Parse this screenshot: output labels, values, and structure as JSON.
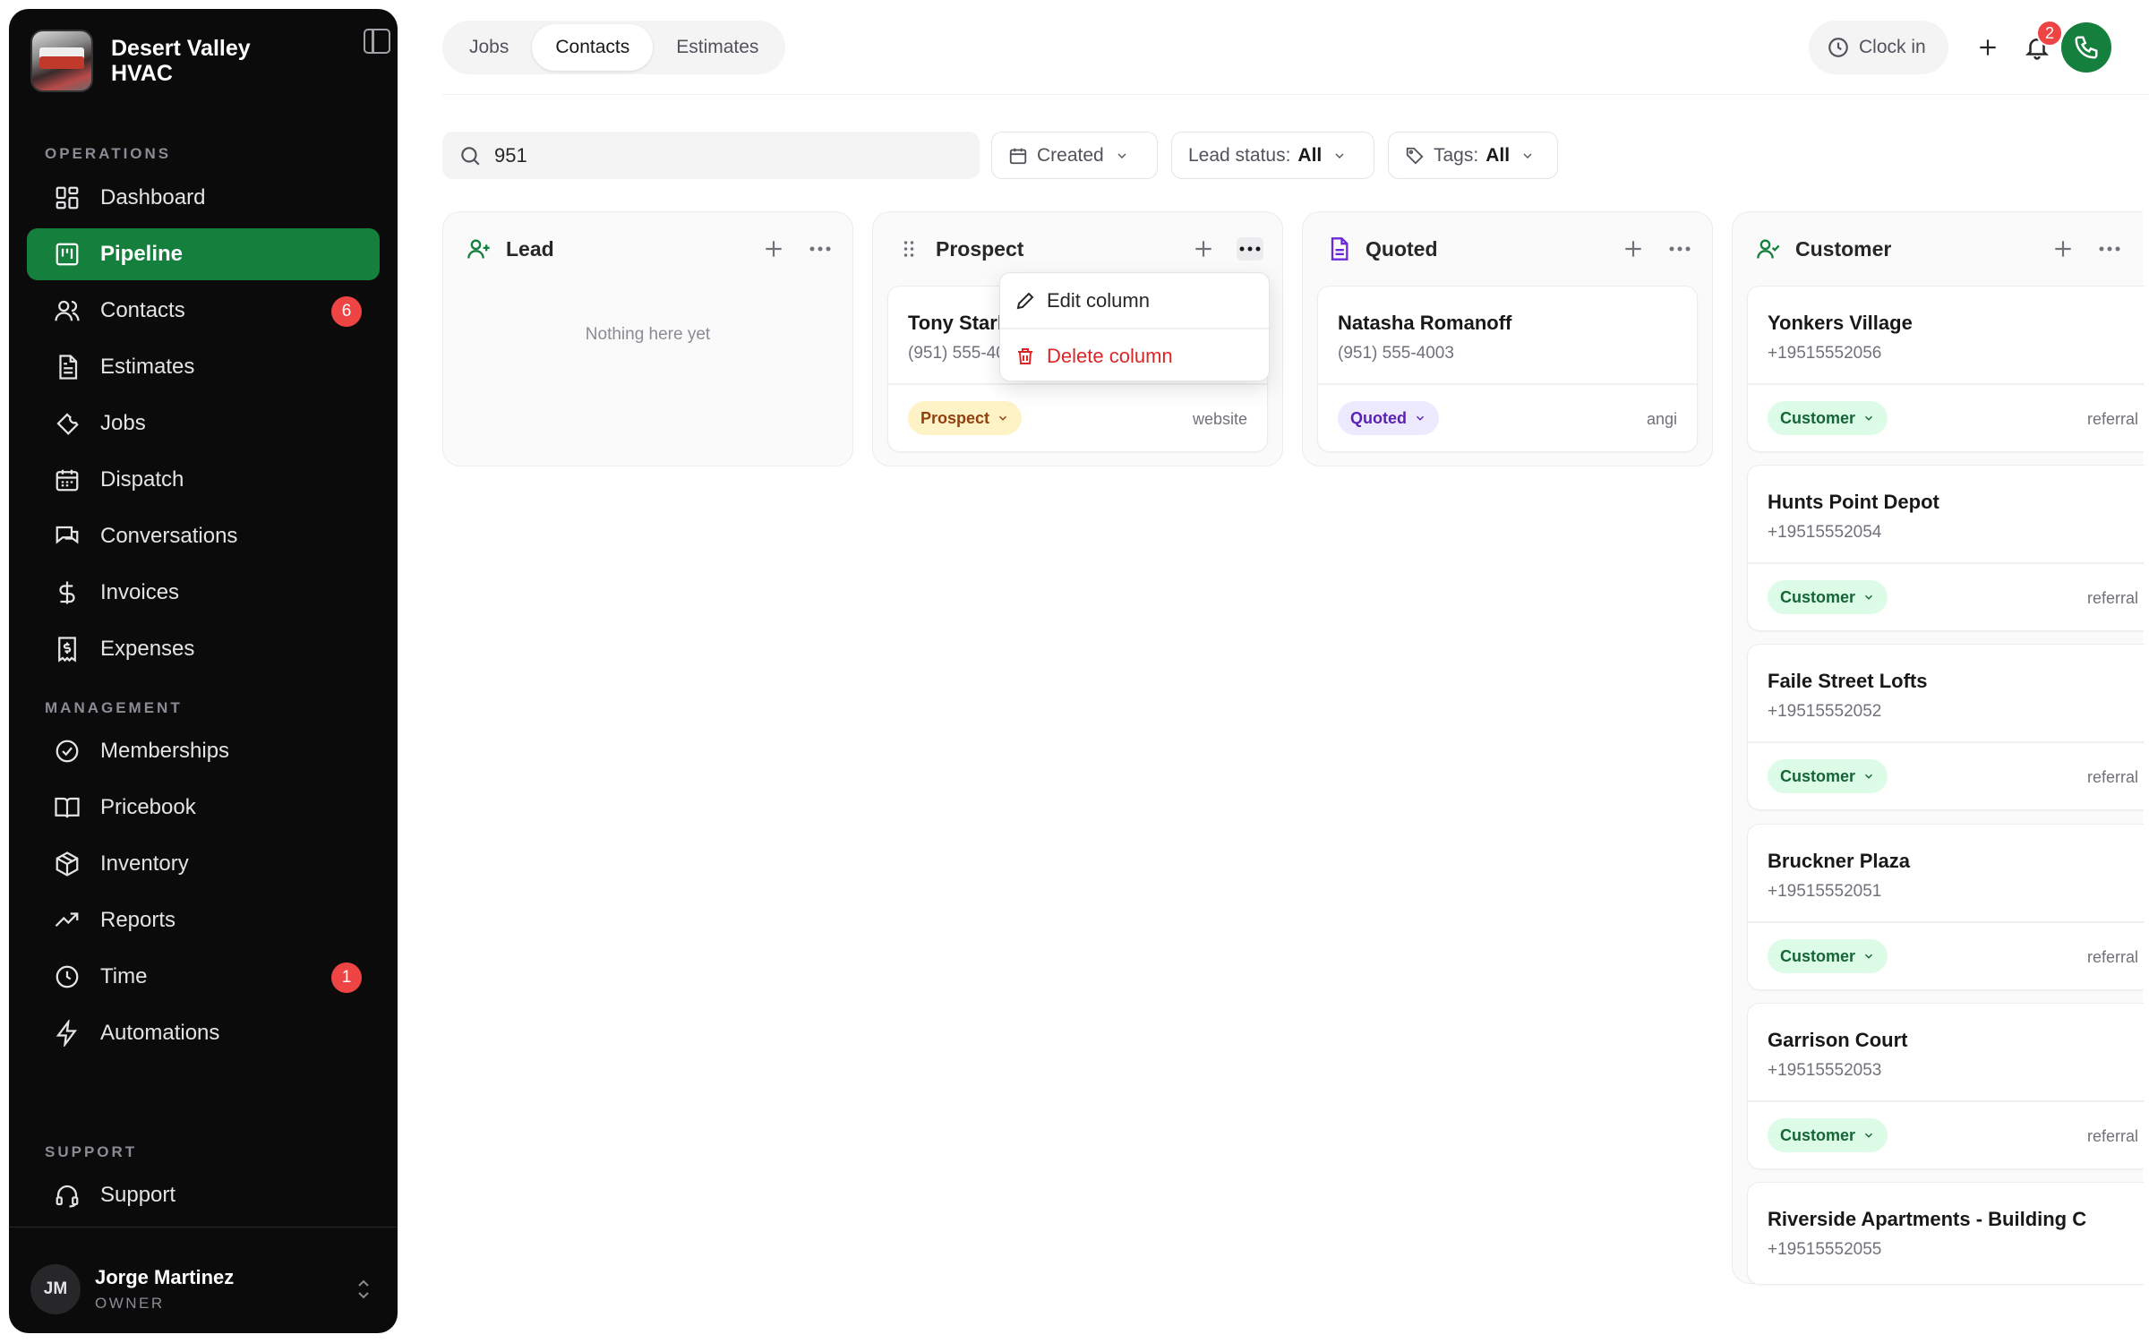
{
  "company": {
    "name": "Desert Valley HVAC"
  },
  "sidebar": {
    "sections": {
      "operations": "OPERATIONS",
      "management": "MANAGEMENT",
      "support": "SUPPORT"
    },
    "items": [
      {
        "label": "Dashboard",
        "icon": "dashboard-icon"
      },
      {
        "label": "Pipeline",
        "icon": "pipeline-icon",
        "active": true
      },
      {
        "label": "Contacts",
        "icon": "contacts-icon",
        "badge": "6"
      },
      {
        "label": "Estimates",
        "icon": "estimates-icon"
      },
      {
        "label": "Jobs",
        "icon": "wrench-icon"
      },
      {
        "label": "Dispatch",
        "icon": "calendar-icon"
      },
      {
        "label": "Conversations",
        "icon": "chat-icon"
      },
      {
        "label": "Invoices",
        "icon": "dollar-icon"
      },
      {
        "label": "Expenses",
        "icon": "receipt-icon"
      },
      {
        "label": "Memberships",
        "icon": "badge-check-icon"
      },
      {
        "label": "Pricebook",
        "icon": "book-icon"
      },
      {
        "label": "Inventory",
        "icon": "box-icon"
      },
      {
        "label": "Reports",
        "icon": "trend-icon"
      },
      {
        "label": "Time",
        "icon": "clock-icon",
        "badge": "1"
      },
      {
        "label": "Automations",
        "icon": "bolt-icon"
      },
      {
        "label": "Support",
        "icon": "headset-icon"
      }
    ]
  },
  "user": {
    "initials": "JM",
    "name": "Jorge Martinez",
    "role": "OWNER"
  },
  "tabs": [
    "Jobs",
    "Contacts",
    "Estimates"
  ],
  "topbar": {
    "clock_in": "Clock in",
    "notifications": "2"
  },
  "filters": {
    "search_value": "951",
    "created": "Created",
    "lead_status_label": "Lead status:",
    "lead_status_value": "All",
    "tags_label": "Tags:",
    "tags_value": "All"
  },
  "columns": [
    {
      "title": "Lead",
      "empty": "Nothing here yet",
      "cards": []
    },
    {
      "title": "Prospect",
      "cards": [
        {
          "name": "Tony Stark",
          "phone": "(951) 555-4001",
          "status": "Prospect",
          "source": "website"
        }
      ]
    },
    {
      "title": "Quoted",
      "cards": [
        {
          "name": "Natasha Romanoff",
          "phone": "(951) 555-4003",
          "status": "Quoted",
          "source": "angi"
        }
      ]
    },
    {
      "title": "Customer",
      "cards": [
        {
          "name": "Yonkers Village",
          "phone": "+19515552056",
          "status": "Customer",
          "source": "referral"
        },
        {
          "name": "Hunts Point Depot",
          "phone": "+19515552054",
          "status": "Customer",
          "source": "referral"
        },
        {
          "name": "Faile Street Lofts",
          "phone": "+19515552052",
          "status": "Customer",
          "source": "referral"
        },
        {
          "name": "Bruckner Plaza",
          "phone": "+19515552051",
          "status": "Customer",
          "source": "referral"
        },
        {
          "name": "Garrison Court",
          "phone": "+19515552053",
          "status": "Customer",
          "source": "referral"
        },
        {
          "name": "Riverside Apartments - Building C",
          "phone": "+19515552055"
        }
      ]
    }
  ],
  "menu": {
    "edit": "Edit column",
    "delete": "Delete column"
  },
  "colors": {
    "accent": "#15803d",
    "danger": "#ef4444",
    "sidebar_bg": "#0b0b0c"
  }
}
